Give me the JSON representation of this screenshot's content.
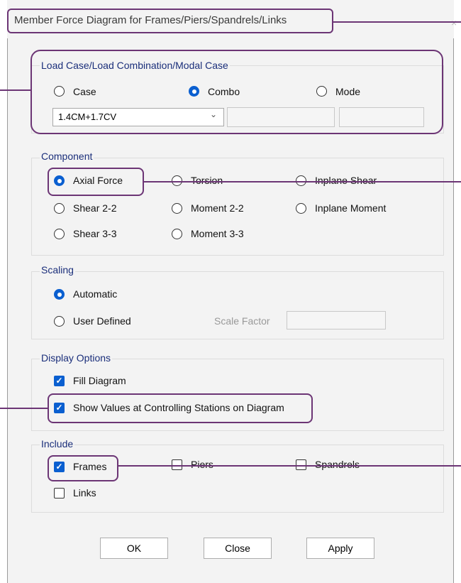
{
  "window": {
    "title": "Member Force Diagram for Frames/Piers/Spandrels/Links"
  },
  "load_case": {
    "legend": "Load Case/Load Combination/Modal Case",
    "options": [
      {
        "label": "Case",
        "selected": false
      },
      {
        "label": "Combo",
        "selected": true
      },
      {
        "label": "Mode",
        "selected": false
      }
    ],
    "selected_value": "1.4CM+1.7CV"
  },
  "component": {
    "legend": "Component",
    "options": [
      {
        "label": "Axial Force",
        "selected": true
      },
      {
        "label": "Torsion",
        "selected": false
      },
      {
        "label": "Inplane Shear",
        "selected": false
      },
      {
        "label": "Shear 2-2",
        "selected": false
      },
      {
        "label": "Moment 2-2",
        "selected": false
      },
      {
        "label": "Inplane Moment",
        "selected": false
      },
      {
        "label": "Shear 3-3",
        "selected": false
      },
      {
        "label": "Moment 3-3",
        "selected": false
      }
    ]
  },
  "scaling": {
    "legend": "Scaling",
    "options": [
      {
        "label": "Automatic",
        "selected": true
      },
      {
        "label": "User Defined",
        "selected": false
      }
    ],
    "scale_factor_label": "Scale Factor"
  },
  "display_options": {
    "legend": "Display Options",
    "fill_diagram": {
      "label": "Fill Diagram",
      "checked": true
    },
    "show_values": {
      "label": "Show Values at Controlling Stations on Diagram",
      "checked": true
    }
  },
  "include": {
    "legend": "Include",
    "items": [
      {
        "label": "Frames",
        "checked": true
      },
      {
        "label": "Piers",
        "checked": false
      },
      {
        "label": "Spandrels",
        "checked": false
      },
      {
        "label": "Links",
        "checked": false
      }
    ]
  },
  "buttons": {
    "ok": "OK",
    "close": "Close",
    "apply": "Apply"
  },
  "colors": {
    "accent": "#0a5fd0",
    "highlight": "#6c3575",
    "legend_text": "#1a2e7a"
  }
}
